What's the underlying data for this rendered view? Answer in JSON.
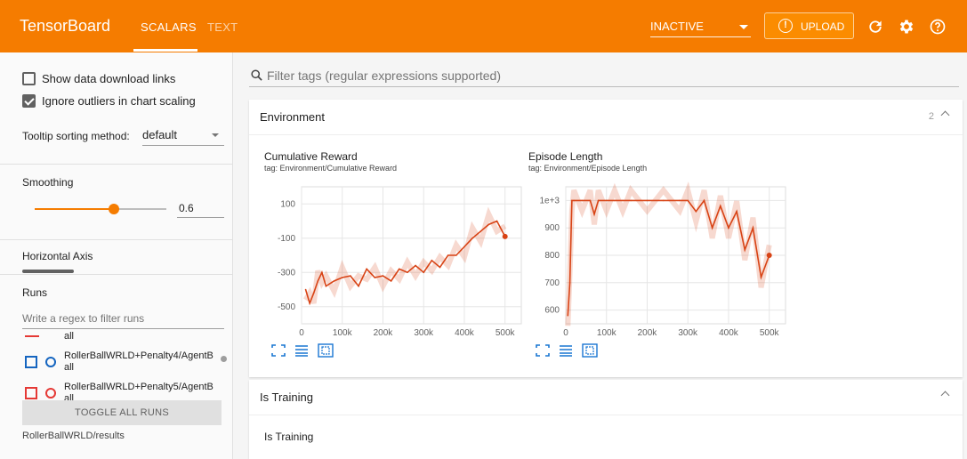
{
  "header": {
    "brand": "TensorBoard",
    "tabs": [
      {
        "label": "SCALARS",
        "active": true
      },
      {
        "label": "TEXT",
        "active": false
      }
    ],
    "run_select": "INACTIVE",
    "upload_label": "UPLOAD",
    "accent": "#f57c00",
    "icons": [
      "refresh-icon",
      "gear-icon",
      "help-icon"
    ]
  },
  "sidebar": {
    "show_download_links": "Show data download links",
    "ignore_outliers": "Ignore outliers in chart scaling",
    "tooltip_label": "Tooltip sorting method:",
    "tooltip_value": "default",
    "smoothing_label": "Smoothing",
    "smoothing_value": "0.6",
    "smoothing_fraction": 0.6,
    "horizontal_axis_label": "Horizontal Axis",
    "runs_label": "Runs",
    "runs_filter_placeholder": "Write a regex to filter runs",
    "partial_run_label": "all",
    "runs": [
      {
        "name_line1": "RollerBallWRLD+Penalty4/AgentB",
        "name_line2": "all",
        "color": "#1565c0"
      },
      {
        "name_line1": "RollerBallWRLD+Penalty5/AgentB",
        "name_line2": "all",
        "color": "#e53935"
      }
    ],
    "toggle_all": "TOGGLE ALL RUNS",
    "logdir": "RollerBallWRLD/results"
  },
  "main": {
    "filter_placeholder": "Filter tags (regular expressions supported)",
    "sections": [
      {
        "title": "Environment",
        "count": "2"
      },
      {
        "title": "Is Training",
        "count": ""
      }
    ],
    "is_training_chart_title": "Is Training"
  },
  "chart_data": [
    {
      "type": "line",
      "title": "Cumulative Reward",
      "subtitle": "tag: Environment/Cumulative Reward",
      "xlabel": "",
      "ylabel": "",
      "x_ticks": [
        "0",
        "100k",
        "200k",
        "300k",
        "400k",
        "500k"
      ],
      "y_ticks": [
        "100",
        "-100",
        "-300",
        "-500"
      ],
      "xlim": [
        0,
        540000
      ],
      "ylim": [
        -600,
        200
      ],
      "series": [
        {
          "color": "#d84315",
          "x": [
            10000,
            20000,
            30000,
            40000,
            50000,
            60000,
            80000,
            100000,
            120000,
            140000,
            160000,
            180000,
            200000,
            220000,
            240000,
            260000,
            280000,
            300000,
            320000,
            340000,
            360000,
            380000,
            400000,
            420000,
            440000,
            460000,
            480000,
            500000
          ],
          "y": [
            -400,
            -480,
            -420,
            -350,
            -300,
            -380,
            -350,
            -330,
            -320,
            -380,
            -280,
            -330,
            -320,
            -350,
            -280,
            -300,
            -260,
            -300,
            -230,
            -270,
            -200,
            -200,
            -150,
            -100,
            -60,
            -20,
            0,
            -90
          ]
        }
      ]
    },
    {
      "type": "line",
      "title": "Episode Length",
      "subtitle": "tag: Environment/Episode Length",
      "xlabel": "",
      "ylabel": "",
      "x_ticks": [
        "0",
        "100k",
        "200k",
        "300k",
        "400k",
        "500k"
      ],
      "y_ticks": [
        "1e+3",
        "900",
        "800",
        "700",
        "600"
      ],
      "xlim": [
        0,
        540000
      ],
      "ylim": [
        550,
        1050
      ],
      "series": [
        {
          "color": "#d84315",
          "x": [
            5000,
            10000,
            15000,
            20000,
            40000,
            60000,
            70000,
            80000,
            100000,
            120000,
            140000,
            160000,
            200000,
            240000,
            280000,
            300000,
            320000,
            340000,
            360000,
            380000,
            400000,
            420000,
            440000,
            460000,
            480000,
            500000
          ],
          "y": [
            580,
            700,
            1000,
            1000,
            1000,
            1000,
            950,
            1000,
            1000,
            1000,
            1000,
            1000,
            1000,
            1000,
            1000,
            1000,
            960,
            1000,
            900,
            980,
            900,
            960,
            820,
            900,
            720,
            800
          ]
        }
      ]
    }
  ]
}
